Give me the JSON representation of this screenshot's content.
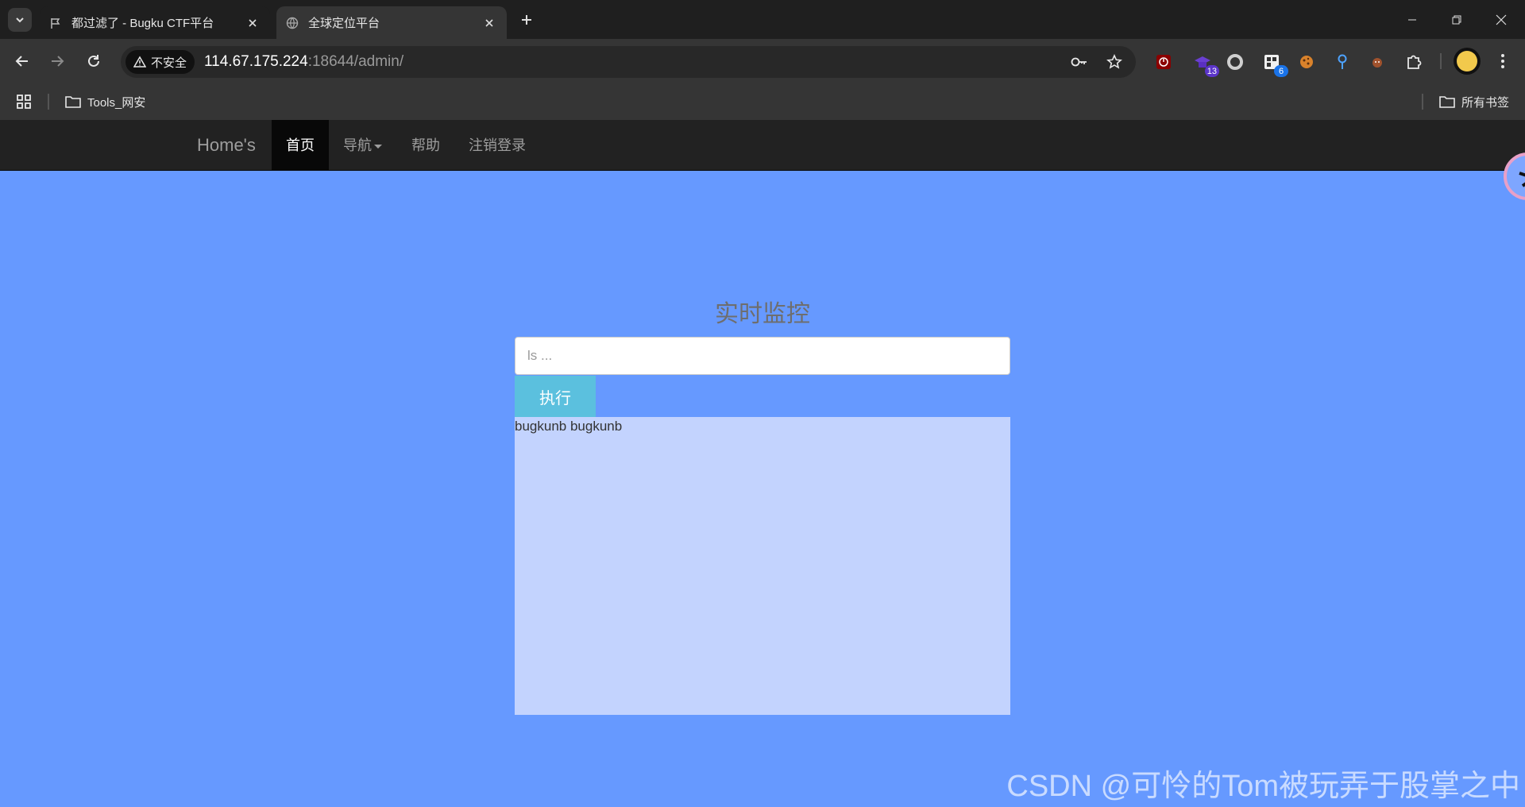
{
  "browser": {
    "tabs": [
      {
        "title": "都过滤了 - Bugku CTF平台",
        "active": false
      },
      {
        "title": "全球定位平台",
        "active": true
      }
    ],
    "security_label": "不安全",
    "url_host": "114.67.175.224",
    "url_rest": ":18644/admin/",
    "extension_badges": [
      "13",
      "6"
    ],
    "bookmarks": {
      "folder": "Tools_网安",
      "all_bookmarks": "所有书签"
    }
  },
  "site": {
    "brand": "Home's",
    "nav": [
      {
        "label": "首页",
        "active": true
      },
      {
        "label": "导航",
        "dropdown": true
      },
      {
        "label": "帮助"
      },
      {
        "label": "注销登录"
      }
    ]
  },
  "panel": {
    "title": "实时监控",
    "input_placeholder": "ls ...",
    "input_value": "",
    "button_label": "执行",
    "output_text": "bugkunb bugkunb"
  },
  "watermark": "CSDN @可怜的Tom被玩弄于股掌之中",
  "colors": {
    "page_bg": "#6699ff",
    "navbar_bg": "#222222",
    "button_bg": "#5bc0de",
    "output_bg": "#c3d3fe"
  }
}
